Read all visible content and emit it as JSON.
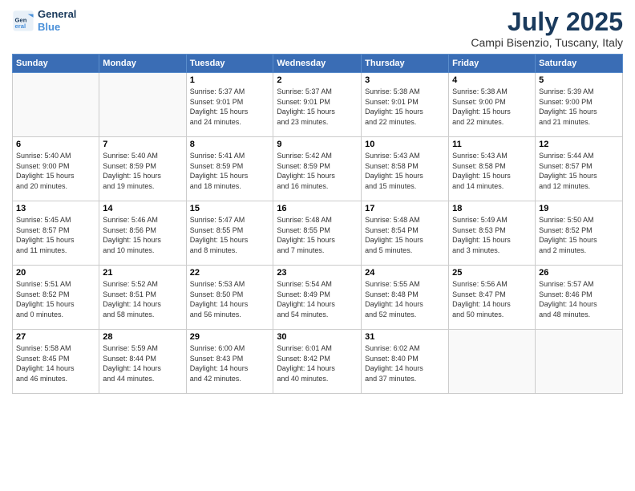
{
  "logo": {
    "line1": "General",
    "line2": "Blue"
  },
  "title": "July 2025",
  "subtitle": "Campi Bisenzio, Tuscany, Italy",
  "weekdays": [
    "Sunday",
    "Monday",
    "Tuesday",
    "Wednesday",
    "Thursday",
    "Friday",
    "Saturday"
  ],
  "weeks": [
    [
      {
        "day": "",
        "detail": ""
      },
      {
        "day": "",
        "detail": ""
      },
      {
        "day": "1",
        "detail": "Sunrise: 5:37 AM\nSunset: 9:01 PM\nDaylight: 15 hours\nand 24 minutes."
      },
      {
        "day": "2",
        "detail": "Sunrise: 5:37 AM\nSunset: 9:01 PM\nDaylight: 15 hours\nand 23 minutes."
      },
      {
        "day": "3",
        "detail": "Sunrise: 5:38 AM\nSunset: 9:01 PM\nDaylight: 15 hours\nand 22 minutes."
      },
      {
        "day": "4",
        "detail": "Sunrise: 5:38 AM\nSunset: 9:00 PM\nDaylight: 15 hours\nand 22 minutes."
      },
      {
        "day": "5",
        "detail": "Sunrise: 5:39 AM\nSunset: 9:00 PM\nDaylight: 15 hours\nand 21 minutes."
      }
    ],
    [
      {
        "day": "6",
        "detail": "Sunrise: 5:40 AM\nSunset: 9:00 PM\nDaylight: 15 hours\nand 20 minutes."
      },
      {
        "day": "7",
        "detail": "Sunrise: 5:40 AM\nSunset: 8:59 PM\nDaylight: 15 hours\nand 19 minutes."
      },
      {
        "day": "8",
        "detail": "Sunrise: 5:41 AM\nSunset: 8:59 PM\nDaylight: 15 hours\nand 18 minutes."
      },
      {
        "day": "9",
        "detail": "Sunrise: 5:42 AM\nSunset: 8:59 PM\nDaylight: 15 hours\nand 16 minutes."
      },
      {
        "day": "10",
        "detail": "Sunrise: 5:43 AM\nSunset: 8:58 PM\nDaylight: 15 hours\nand 15 minutes."
      },
      {
        "day": "11",
        "detail": "Sunrise: 5:43 AM\nSunset: 8:58 PM\nDaylight: 15 hours\nand 14 minutes."
      },
      {
        "day": "12",
        "detail": "Sunrise: 5:44 AM\nSunset: 8:57 PM\nDaylight: 15 hours\nand 12 minutes."
      }
    ],
    [
      {
        "day": "13",
        "detail": "Sunrise: 5:45 AM\nSunset: 8:57 PM\nDaylight: 15 hours\nand 11 minutes."
      },
      {
        "day": "14",
        "detail": "Sunrise: 5:46 AM\nSunset: 8:56 PM\nDaylight: 15 hours\nand 10 minutes."
      },
      {
        "day": "15",
        "detail": "Sunrise: 5:47 AM\nSunset: 8:55 PM\nDaylight: 15 hours\nand 8 minutes."
      },
      {
        "day": "16",
        "detail": "Sunrise: 5:48 AM\nSunset: 8:55 PM\nDaylight: 15 hours\nand 7 minutes."
      },
      {
        "day": "17",
        "detail": "Sunrise: 5:48 AM\nSunset: 8:54 PM\nDaylight: 15 hours\nand 5 minutes."
      },
      {
        "day": "18",
        "detail": "Sunrise: 5:49 AM\nSunset: 8:53 PM\nDaylight: 15 hours\nand 3 minutes."
      },
      {
        "day": "19",
        "detail": "Sunrise: 5:50 AM\nSunset: 8:52 PM\nDaylight: 15 hours\nand 2 minutes."
      }
    ],
    [
      {
        "day": "20",
        "detail": "Sunrise: 5:51 AM\nSunset: 8:52 PM\nDaylight: 15 hours\nand 0 minutes."
      },
      {
        "day": "21",
        "detail": "Sunrise: 5:52 AM\nSunset: 8:51 PM\nDaylight: 14 hours\nand 58 minutes."
      },
      {
        "day": "22",
        "detail": "Sunrise: 5:53 AM\nSunset: 8:50 PM\nDaylight: 14 hours\nand 56 minutes."
      },
      {
        "day": "23",
        "detail": "Sunrise: 5:54 AM\nSunset: 8:49 PM\nDaylight: 14 hours\nand 54 minutes."
      },
      {
        "day": "24",
        "detail": "Sunrise: 5:55 AM\nSunset: 8:48 PM\nDaylight: 14 hours\nand 52 minutes."
      },
      {
        "day": "25",
        "detail": "Sunrise: 5:56 AM\nSunset: 8:47 PM\nDaylight: 14 hours\nand 50 minutes."
      },
      {
        "day": "26",
        "detail": "Sunrise: 5:57 AM\nSunset: 8:46 PM\nDaylight: 14 hours\nand 48 minutes."
      }
    ],
    [
      {
        "day": "27",
        "detail": "Sunrise: 5:58 AM\nSunset: 8:45 PM\nDaylight: 14 hours\nand 46 minutes."
      },
      {
        "day": "28",
        "detail": "Sunrise: 5:59 AM\nSunset: 8:44 PM\nDaylight: 14 hours\nand 44 minutes."
      },
      {
        "day": "29",
        "detail": "Sunrise: 6:00 AM\nSunset: 8:43 PM\nDaylight: 14 hours\nand 42 minutes."
      },
      {
        "day": "30",
        "detail": "Sunrise: 6:01 AM\nSunset: 8:42 PM\nDaylight: 14 hours\nand 40 minutes."
      },
      {
        "day": "31",
        "detail": "Sunrise: 6:02 AM\nSunset: 8:40 PM\nDaylight: 14 hours\nand 37 minutes."
      },
      {
        "day": "",
        "detail": ""
      },
      {
        "day": "",
        "detail": ""
      }
    ]
  ]
}
